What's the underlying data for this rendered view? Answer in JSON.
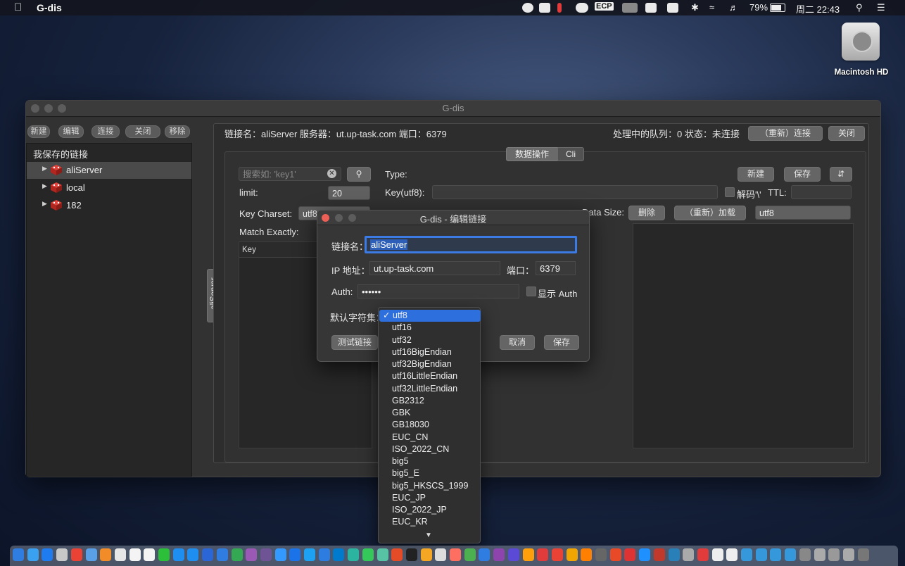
{
  "menubar": {
    "app_name": "G-dis",
    "ecp": "ECP",
    "battery": "79%",
    "clock": "周二 22:43"
  },
  "desktop": {
    "hd_label": "Macintosh HD"
  },
  "window": {
    "title": "G-dis",
    "toolbar": {
      "new": "新建",
      "edit": "编辑",
      "connect": "连接",
      "close": "关闭",
      "remove": "移除"
    },
    "sidebar": {
      "title": "我保存的链接",
      "items": [
        {
          "label": "aliServer"
        },
        {
          "label": "local"
        },
        {
          "label": "182"
        }
      ]
    },
    "vertical_tab": "aliServer",
    "conn_info": "链接名：aliServer  服务器：ut.up-task.com  端口：6379",
    "queue_status": "处理中的队列：0   状态：未连接",
    "reconnect": "（重新）连接",
    "close_conn": "关闭",
    "tabs": [
      "数据操作",
      "Cli"
    ],
    "search_placeholder": "搜索如: 'key1'",
    "limit_label": "limit:",
    "limit_value": "20",
    "key_charset_label": "Key Charset:",
    "key_charset_value": "utf8",
    "match_exactly_label": "Match Exactly:",
    "key_col": "Key",
    "type_label": "Type:",
    "key_utf8_label": "Key(utf8):",
    "decode_label": "解码'\\'",
    "ttl_label": "TTL:",
    "new_btn": "新建",
    "save_btn": "保存",
    "data_size_label": "Data Size:",
    "delete_btn": "删除",
    "reload_btn": "（重新）加载",
    "value_charset": "utf8",
    "kv_label": "Ke  Ch"
  },
  "dialog": {
    "title": "G-dis - 编辑链接",
    "name_label": "链接名：",
    "name_value": "aliServer",
    "ip_label": "IP 地址：",
    "ip_value": "ut.up-task.com",
    "port_label": "端口：",
    "port_value": "6379",
    "auth_label": "Auth:",
    "auth_value": "••••••",
    "show_auth": "显示 Auth",
    "charset_label": "默认字符集：",
    "test_btn": "测试链接",
    "cancel_btn": "取消",
    "save_btn": "保存"
  },
  "charset_options": [
    "utf8",
    "utf16",
    "utf32",
    "utf16BigEndian",
    "utf32BigEndian",
    "utf16LittleEndian",
    "utf32LittleEndian",
    "GB2312",
    "GBK",
    "GB18030",
    "EUC_CN",
    "ISO_2022_CN",
    "big5",
    "big5_E",
    "big5_HKSCS_1999",
    "EUC_JP",
    "ISO_2022_JP",
    "EUC_KR"
  ],
  "charset_selected": "utf8",
  "colors": {
    "accent": "#2e6fde",
    "selection": "#3b7be3",
    "window_bg": "#323232"
  }
}
